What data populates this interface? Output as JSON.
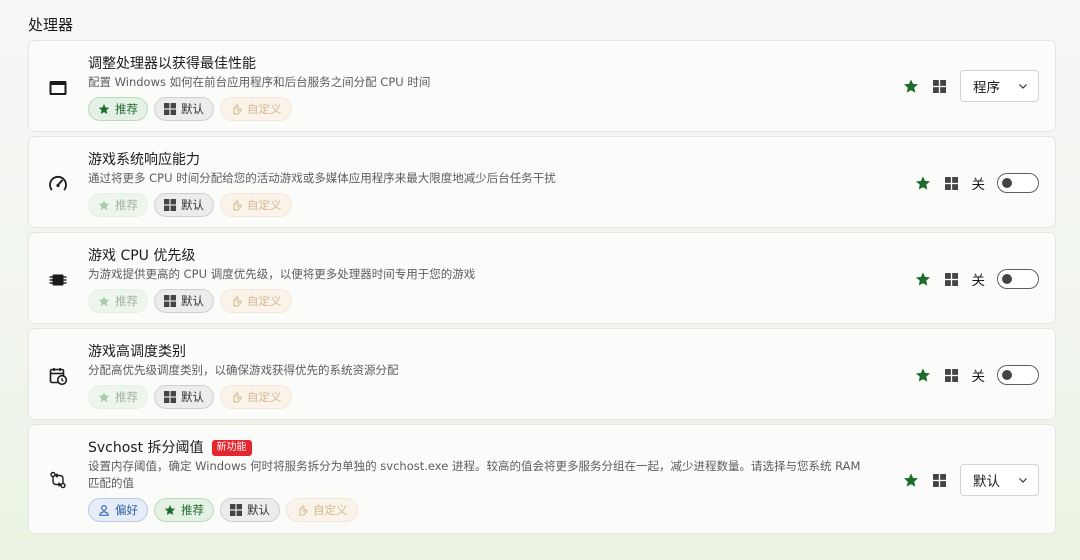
{
  "section": {
    "title": "处理器"
  },
  "colors": {
    "accent_green": "#1e6b2d",
    "new_badge": "#e4262f"
  },
  "chip_labels": {
    "recommend": "推荐",
    "default": "默认",
    "custom": "自定义",
    "preference": "偏好"
  },
  "settings": [
    {
      "title": "调整处理器以获得最佳性能",
      "description": "配置 Windows 如何在前台应用程序和后台服务之间分配 CPU 时间",
      "icon": "window-icon",
      "control": "dropdown",
      "value": "程序"
    },
    {
      "title": "游戏系统响应能力",
      "description": "通过将更多 CPU 时间分配给您的活动游戏或多媒体应用程序来最大限度地减少后台任务干扰",
      "icon": "speedometer-icon",
      "control": "toggle",
      "value": "关"
    },
    {
      "title": "游戏 CPU 优先级",
      "description": "为游戏提供更高的 CPU 调度优先级，以便将更多处理器时间专用于您的游戏",
      "icon": "chip-icon",
      "control": "toggle",
      "value": "关"
    },
    {
      "title": "游戏高调度类别",
      "description": "分配高优先级调度类别，以确保游戏获得优先的系统资源分配",
      "icon": "calendar-clock-icon",
      "control": "toggle",
      "value": "关"
    },
    {
      "title": "Svchost 拆分阈值",
      "badge": "新功能",
      "description": "设置内存阈值，确定 Windows 何时将服务拆分为单独的 svchost.exe 进程。较高的值会将更多服务分组在一起，减少进程数量。请选择与您系统 RAM 匹配的值",
      "icon": "sync-arrows-icon",
      "control": "dropdown",
      "value": "默认"
    }
  ]
}
